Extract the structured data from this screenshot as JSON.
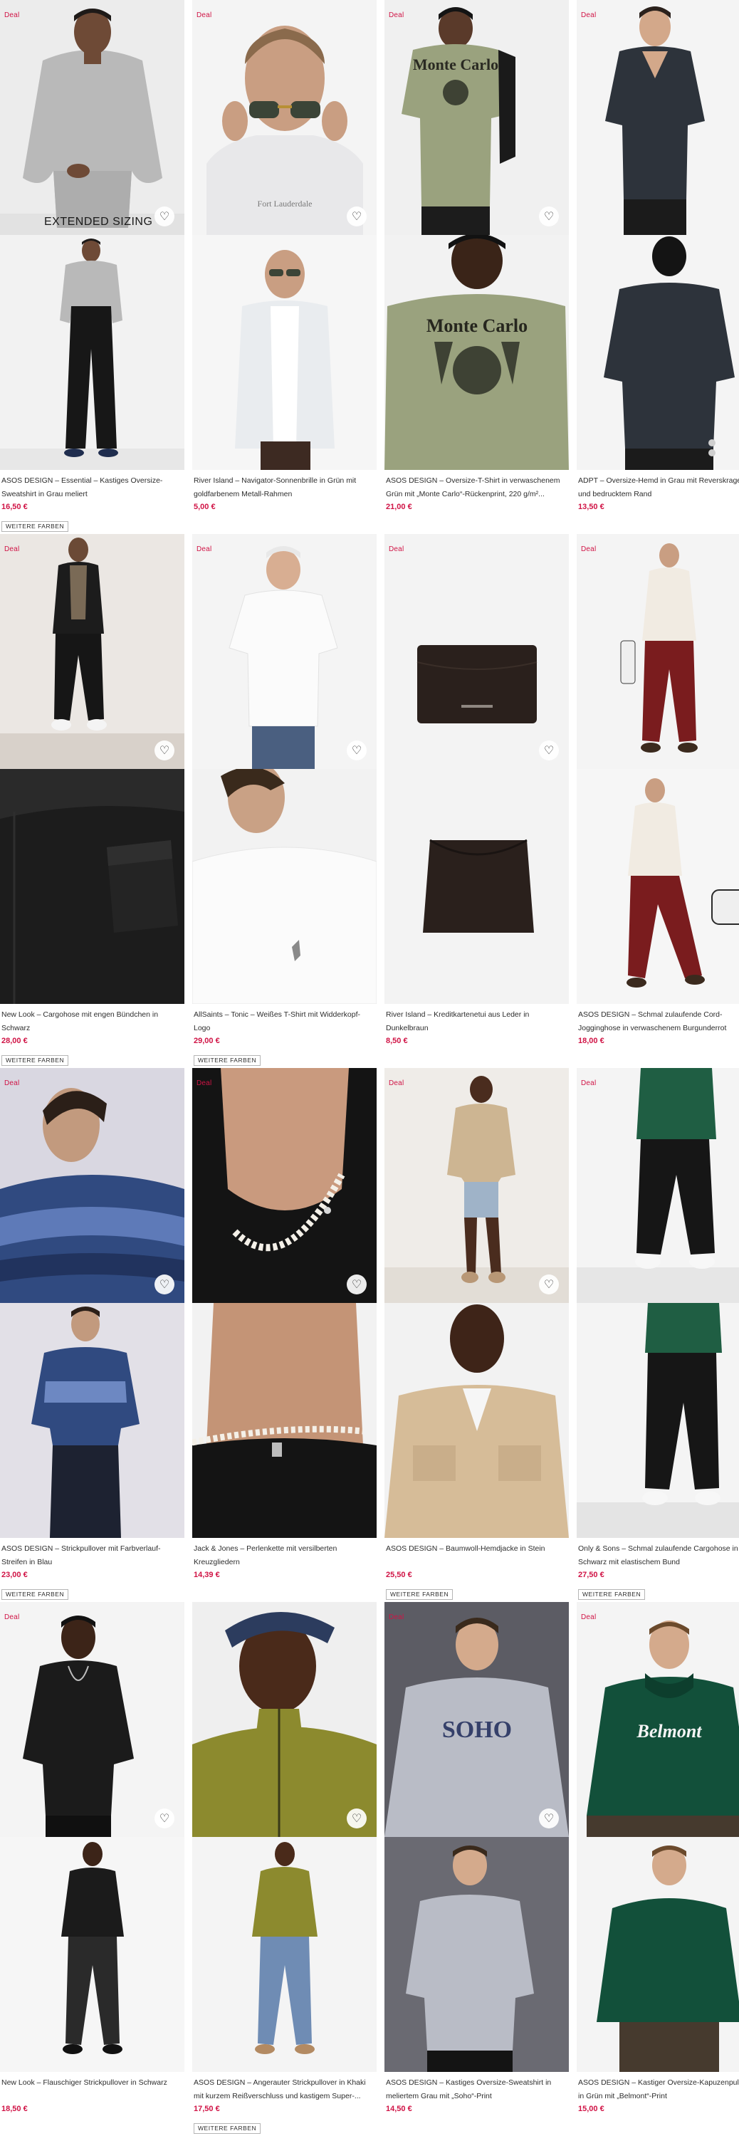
{
  "labels": {
    "deal": "Deal",
    "more_colors": "WEITERE FARBEN",
    "extended_sizing": "EXTENDED SIZING",
    "heart": "♡"
  },
  "colors": {
    "price": "#d01345",
    "deal": "#d01345",
    "text": "#2d2d2d"
  },
  "products": [
    {
      "title": "ASOS DESIGN – Essential – Kastiges Oversize-Sweatshirt in Grau meliert",
      "price": "16,50 €",
      "deal": true,
      "more_colors": true,
      "extended_sizing": true
    },
    {
      "title": "River Island – Navigator-Sonnenbrille in Grün mit goldfarbenem Metall-Rahmen",
      "price": "5,00 €",
      "deal": true,
      "more_colors": false
    },
    {
      "title": "ASOS DESIGN – Oversize-T-Shirt in verwaschenem Grün mit „Monte Carlo“-Rückenprint, 220 g/m²...",
      "price": "21,00 €",
      "deal": true,
      "more_colors": false,
      "print_text": "Monte Carlo"
    },
    {
      "title": "ADPT – Oversize-Hemd in Grau mit Reverskragen und bedrucktem Rand",
      "price": "13,50 €",
      "deal": true,
      "more_colors": false
    },
    {
      "title": "New Look – Cargohose mit engen Bündchen in Schwarz",
      "price": "28,00 €",
      "deal": true,
      "more_colors": true
    },
    {
      "title": "AllSaints – Tonic – Weißes T-Shirt mit Widderkopf-Logo",
      "price": "29,00 €",
      "deal": true,
      "more_colors": true
    },
    {
      "title": "River Island – Kreditkartenetui aus Leder in Dunkelbraun",
      "price": "8,50 €",
      "deal": true,
      "more_colors": false
    },
    {
      "title": "ASOS DESIGN – Schmal zulaufende Cord-Jogginghose in verwaschenem Burgunderrot",
      "price": "18,00 €",
      "deal": true,
      "more_colors": false
    },
    {
      "title": "ASOS DESIGN – Strickpullover mit Farbverlauf-Streifen in Blau",
      "price": "23,00 €",
      "deal": true,
      "more_colors": true
    },
    {
      "title": "Jack & Jones – Perlenkette mit versilberten Kreuzgliedern",
      "price": "14,39 €",
      "deal": true,
      "more_colors": false
    },
    {
      "title": "ASOS DESIGN – Baumwoll-Hemdjacke in Stein",
      "price": "25,50 €",
      "deal": true,
      "more_colors": true
    },
    {
      "title": "Only & Sons – Schmal zulaufende Cargohose in Schwarz mit elastischem Bund",
      "price": "27,50 €",
      "deal": true,
      "more_colors": true
    },
    {
      "title": "New Look – Flauschiger Strickpullover in Schwarz",
      "price": "18,50 €",
      "deal": true,
      "more_colors": false
    },
    {
      "title": "ASOS DESIGN – Angerauter Strickpullover in Khaki mit kurzem Reißverschluss und kastigem Super-...",
      "price": "17,50 €",
      "deal": false,
      "more_colors": true
    },
    {
      "title": "ASOS DESIGN – Kastiges Oversize-Sweatshirt in meliertem Grau mit „Soho“-Print",
      "price": "14,50 €",
      "deal": true,
      "more_colors": false,
      "print_text": "SOHO"
    },
    {
      "title": "ASOS DESIGN – Kastiger Oversize-Kapuzenpullover in Grün mit „Belmont“-Print",
      "price": "15,00 €",
      "deal": true,
      "more_colors": false,
      "print_text": "Belmont"
    }
  ]
}
